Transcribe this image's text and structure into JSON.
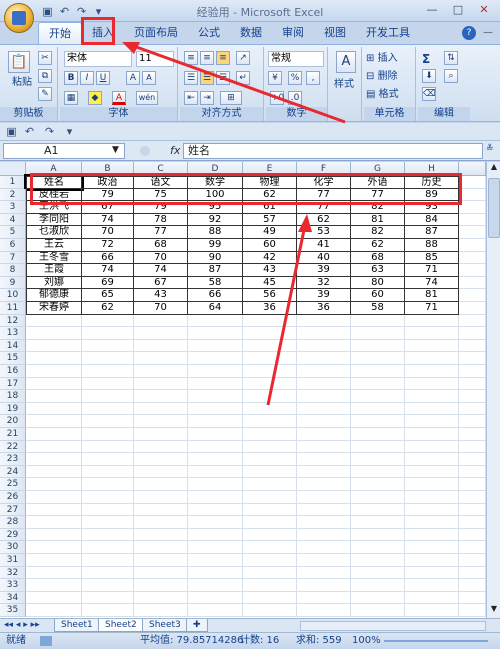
{
  "window": {
    "title": "经验用 - Microsoft Excel"
  },
  "tabs": [
    "开始",
    "插入",
    "页面布局",
    "公式",
    "数据",
    "审阅",
    "视图",
    "开发工具"
  ],
  "ribbon": {
    "clipboard": {
      "paste": "粘贴",
      "label": "剪贴板"
    },
    "font": {
      "name": "宋体",
      "size": "11",
      "bold": "B",
      "italic": "I",
      "underline": "U",
      "grow": "A",
      "shrink": "A",
      "font_color": "A",
      "phonetic": "wén",
      "label": "字体"
    },
    "alignment": {
      "label": "对齐方式"
    },
    "number": {
      "format": "常规",
      "percent": "%",
      "comma": ",",
      "label": "数字"
    },
    "styles": {
      "label": "样式"
    },
    "cells": {
      "insert": "插入",
      "delete": "删除",
      "format": "格式",
      "label": "单元格"
    },
    "editing": {
      "sum": "Σ",
      "label": "编辑"
    }
  },
  "formula_bar": {
    "name_box": "A1",
    "fx": "fx",
    "content": "姓名"
  },
  "columns": [
    "A",
    "B",
    "C",
    "D",
    "E",
    "F",
    "G",
    "H"
  ],
  "rows": [
    "1",
    "2",
    "3",
    "4",
    "5",
    "6",
    "7",
    "8",
    "9",
    "10",
    "11",
    "12",
    "13",
    "14",
    "15",
    "16",
    "17",
    "18",
    "19",
    "20",
    "21",
    "22",
    "23",
    "24",
    "25",
    "26",
    "27",
    "28",
    "29",
    "30",
    "31",
    "32",
    "33",
    "34",
    "35"
  ],
  "table": [
    [
      "姓名",
      "政治",
      "语文",
      "数学",
      "物理",
      "化学",
      "外语",
      "历史"
    ],
    [
      "皮桂岩",
      "79",
      "75",
      "100",
      "62",
      "77",
      "77",
      "89"
    ],
    [
      "王洪飞",
      "67",
      "79",
      "95",
      "61",
      "77",
      "82",
      "93"
    ],
    [
      "李同阳",
      "74",
      "78",
      "92",
      "57",
      "62",
      "81",
      "84"
    ],
    [
      "乜淑欣",
      "70",
      "77",
      "88",
      "49",
      "53",
      "82",
      "87"
    ],
    [
      "王云",
      "72",
      "68",
      "99",
      "60",
      "41",
      "62",
      "88"
    ],
    [
      "王冬雪",
      "66",
      "70",
      "90",
      "42",
      "40",
      "68",
      "85"
    ],
    [
      "王霞",
      "74",
      "74",
      "87",
      "43",
      "39",
      "63",
      "71"
    ],
    [
      "刘娜",
      "69",
      "67",
      "58",
      "45",
      "32",
      "80",
      "74"
    ],
    [
      "郁德康",
      "65",
      "43",
      "66",
      "56",
      "39",
      "60",
      "81"
    ],
    [
      "宋春婷",
      "62",
      "70",
      "64",
      "36",
      "36",
      "58",
      "71"
    ]
  ],
  "sheets": [
    "Sheet1",
    "Sheet2",
    "Sheet3"
  ],
  "status": {
    "ready": "就绪",
    "average": "平均值: 79.85714286",
    "count": "计数: 16",
    "sum": "求和: 559",
    "zoom": "100%"
  },
  "annotation_color": "#e8292f"
}
